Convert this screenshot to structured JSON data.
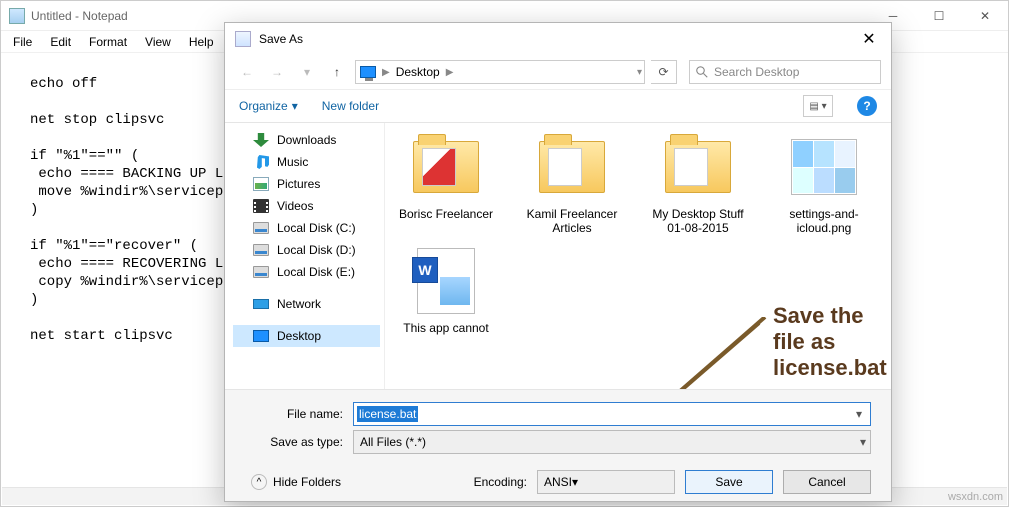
{
  "notepad": {
    "title": "Untitled - Notepad",
    "menu": [
      "File",
      "Edit",
      "Format",
      "View",
      "Help"
    ],
    "body": "echo off\n\nnet stop clipsvc\n\nif \"%1\"==\"\" (\n echo ==== BACKING UP L\n move %windir%\\servicep                                                                                                                     files\\locals\n)\n\nif \"%1\"==\"recover\" (\n echo ==== RECOVERING L\n copy %windir%\\servicep                                                                                                                     files\\locals\n)\n\nnet start clipsvc"
  },
  "dialog": {
    "title": "Save As",
    "breadcrumb": {
      "root": "Desktop"
    },
    "search_placeholder": "Search Desktop",
    "toolbar": {
      "organize": "Organize",
      "newfolder": "New folder"
    },
    "tree": [
      {
        "label": "Downloads",
        "icon": "dl"
      },
      {
        "label": "Music",
        "icon": "music"
      },
      {
        "label": "Pictures",
        "icon": "pic"
      },
      {
        "label": "Videos",
        "icon": "vid"
      },
      {
        "label": "Local Disk (C:)",
        "icon": "disk"
      },
      {
        "label": "Local Disk (D:)",
        "icon": "disk"
      },
      {
        "label": "Local Disk (E:)",
        "icon": "disk"
      },
      {
        "label": "Network",
        "icon": "net",
        "gap": true
      },
      {
        "label": "Desktop",
        "icon": "desk",
        "sel": true,
        "gap": true
      }
    ],
    "files": [
      {
        "name": "Borisc Freelancer",
        "kind": "folder-red"
      },
      {
        "name": "Kamil Freelancer Articles",
        "kind": "folder"
      },
      {
        "name": "My Desktop Stuff 01-08-2015",
        "kind": "folder"
      },
      {
        "name": "settings-and-icloud.png",
        "kind": "image"
      },
      {
        "name": "This app cannot",
        "kind": "word"
      }
    ],
    "fn_label": "File name:",
    "fn_value": "license.bat",
    "type_label": "Save as type:",
    "type_value": "All Files  (*.*)",
    "hide": "Hide Folders",
    "encoding_label": "Encoding:",
    "encoding_value": "ANSI",
    "save": "Save",
    "cancel": "Cancel"
  },
  "annotation": {
    "line1": "Save the file as",
    "line2": "license.bat"
  },
  "watermark": "wsxdn.com"
}
